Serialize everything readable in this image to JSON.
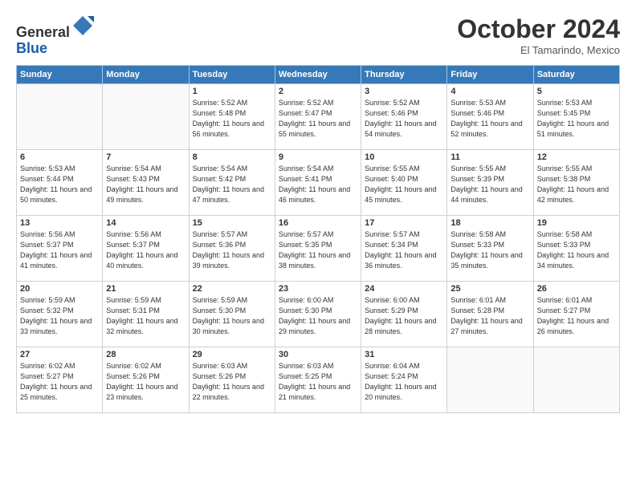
{
  "header": {
    "logo_general": "General",
    "logo_blue": "Blue",
    "month_title": "October 2024",
    "location": "El Tamarindo, Mexico"
  },
  "days_of_week": [
    "Sunday",
    "Monday",
    "Tuesday",
    "Wednesday",
    "Thursday",
    "Friday",
    "Saturday"
  ],
  "weeks": [
    [
      {
        "day": "",
        "sunrise": "",
        "sunset": "",
        "daylight": ""
      },
      {
        "day": "",
        "sunrise": "",
        "sunset": "",
        "daylight": ""
      },
      {
        "day": "1",
        "sunrise": "Sunrise: 5:52 AM",
        "sunset": "Sunset: 5:48 PM",
        "daylight": "Daylight: 11 hours and 56 minutes."
      },
      {
        "day": "2",
        "sunrise": "Sunrise: 5:52 AM",
        "sunset": "Sunset: 5:47 PM",
        "daylight": "Daylight: 11 hours and 55 minutes."
      },
      {
        "day": "3",
        "sunrise": "Sunrise: 5:52 AM",
        "sunset": "Sunset: 5:46 PM",
        "daylight": "Daylight: 11 hours and 54 minutes."
      },
      {
        "day": "4",
        "sunrise": "Sunrise: 5:53 AM",
        "sunset": "Sunset: 5:46 PM",
        "daylight": "Daylight: 11 hours and 52 minutes."
      },
      {
        "day": "5",
        "sunrise": "Sunrise: 5:53 AM",
        "sunset": "Sunset: 5:45 PM",
        "daylight": "Daylight: 11 hours and 51 minutes."
      }
    ],
    [
      {
        "day": "6",
        "sunrise": "Sunrise: 5:53 AM",
        "sunset": "Sunset: 5:44 PM",
        "daylight": "Daylight: 11 hours and 50 minutes."
      },
      {
        "day": "7",
        "sunrise": "Sunrise: 5:54 AM",
        "sunset": "Sunset: 5:43 PM",
        "daylight": "Daylight: 11 hours and 49 minutes."
      },
      {
        "day": "8",
        "sunrise": "Sunrise: 5:54 AM",
        "sunset": "Sunset: 5:42 PM",
        "daylight": "Daylight: 11 hours and 47 minutes."
      },
      {
        "day": "9",
        "sunrise": "Sunrise: 5:54 AM",
        "sunset": "Sunset: 5:41 PM",
        "daylight": "Daylight: 11 hours and 46 minutes."
      },
      {
        "day": "10",
        "sunrise": "Sunrise: 5:55 AM",
        "sunset": "Sunset: 5:40 PM",
        "daylight": "Daylight: 11 hours and 45 minutes."
      },
      {
        "day": "11",
        "sunrise": "Sunrise: 5:55 AM",
        "sunset": "Sunset: 5:39 PM",
        "daylight": "Daylight: 11 hours and 44 minutes."
      },
      {
        "day": "12",
        "sunrise": "Sunrise: 5:55 AM",
        "sunset": "Sunset: 5:38 PM",
        "daylight": "Daylight: 11 hours and 42 minutes."
      }
    ],
    [
      {
        "day": "13",
        "sunrise": "Sunrise: 5:56 AM",
        "sunset": "Sunset: 5:37 PM",
        "daylight": "Daylight: 11 hours and 41 minutes."
      },
      {
        "day": "14",
        "sunrise": "Sunrise: 5:56 AM",
        "sunset": "Sunset: 5:37 PM",
        "daylight": "Daylight: 11 hours and 40 minutes."
      },
      {
        "day": "15",
        "sunrise": "Sunrise: 5:57 AM",
        "sunset": "Sunset: 5:36 PM",
        "daylight": "Daylight: 11 hours and 39 minutes."
      },
      {
        "day": "16",
        "sunrise": "Sunrise: 5:57 AM",
        "sunset": "Sunset: 5:35 PM",
        "daylight": "Daylight: 11 hours and 38 minutes."
      },
      {
        "day": "17",
        "sunrise": "Sunrise: 5:57 AM",
        "sunset": "Sunset: 5:34 PM",
        "daylight": "Daylight: 11 hours and 36 minutes."
      },
      {
        "day": "18",
        "sunrise": "Sunrise: 5:58 AM",
        "sunset": "Sunset: 5:33 PM",
        "daylight": "Daylight: 11 hours and 35 minutes."
      },
      {
        "day": "19",
        "sunrise": "Sunrise: 5:58 AM",
        "sunset": "Sunset: 5:33 PM",
        "daylight": "Daylight: 11 hours and 34 minutes."
      }
    ],
    [
      {
        "day": "20",
        "sunrise": "Sunrise: 5:59 AM",
        "sunset": "Sunset: 5:32 PM",
        "daylight": "Daylight: 11 hours and 33 minutes."
      },
      {
        "day": "21",
        "sunrise": "Sunrise: 5:59 AM",
        "sunset": "Sunset: 5:31 PM",
        "daylight": "Daylight: 11 hours and 32 minutes."
      },
      {
        "day": "22",
        "sunrise": "Sunrise: 5:59 AM",
        "sunset": "Sunset: 5:30 PM",
        "daylight": "Daylight: 11 hours and 30 minutes."
      },
      {
        "day": "23",
        "sunrise": "Sunrise: 6:00 AM",
        "sunset": "Sunset: 5:30 PM",
        "daylight": "Daylight: 11 hours and 29 minutes."
      },
      {
        "day": "24",
        "sunrise": "Sunrise: 6:00 AM",
        "sunset": "Sunset: 5:29 PM",
        "daylight": "Daylight: 11 hours and 28 minutes."
      },
      {
        "day": "25",
        "sunrise": "Sunrise: 6:01 AM",
        "sunset": "Sunset: 5:28 PM",
        "daylight": "Daylight: 11 hours and 27 minutes."
      },
      {
        "day": "26",
        "sunrise": "Sunrise: 6:01 AM",
        "sunset": "Sunset: 5:27 PM",
        "daylight": "Daylight: 11 hours and 26 minutes."
      }
    ],
    [
      {
        "day": "27",
        "sunrise": "Sunrise: 6:02 AM",
        "sunset": "Sunset: 5:27 PM",
        "daylight": "Daylight: 11 hours and 25 minutes."
      },
      {
        "day": "28",
        "sunrise": "Sunrise: 6:02 AM",
        "sunset": "Sunset: 5:26 PM",
        "daylight": "Daylight: 11 hours and 23 minutes."
      },
      {
        "day": "29",
        "sunrise": "Sunrise: 6:03 AM",
        "sunset": "Sunset: 5:26 PM",
        "daylight": "Daylight: 11 hours and 22 minutes."
      },
      {
        "day": "30",
        "sunrise": "Sunrise: 6:03 AM",
        "sunset": "Sunset: 5:25 PM",
        "daylight": "Daylight: 11 hours and 21 minutes."
      },
      {
        "day": "31",
        "sunrise": "Sunrise: 6:04 AM",
        "sunset": "Sunset: 5:24 PM",
        "daylight": "Daylight: 11 hours and 20 minutes."
      },
      {
        "day": "",
        "sunrise": "",
        "sunset": "",
        "daylight": ""
      },
      {
        "day": "",
        "sunrise": "",
        "sunset": "",
        "daylight": ""
      }
    ]
  ]
}
